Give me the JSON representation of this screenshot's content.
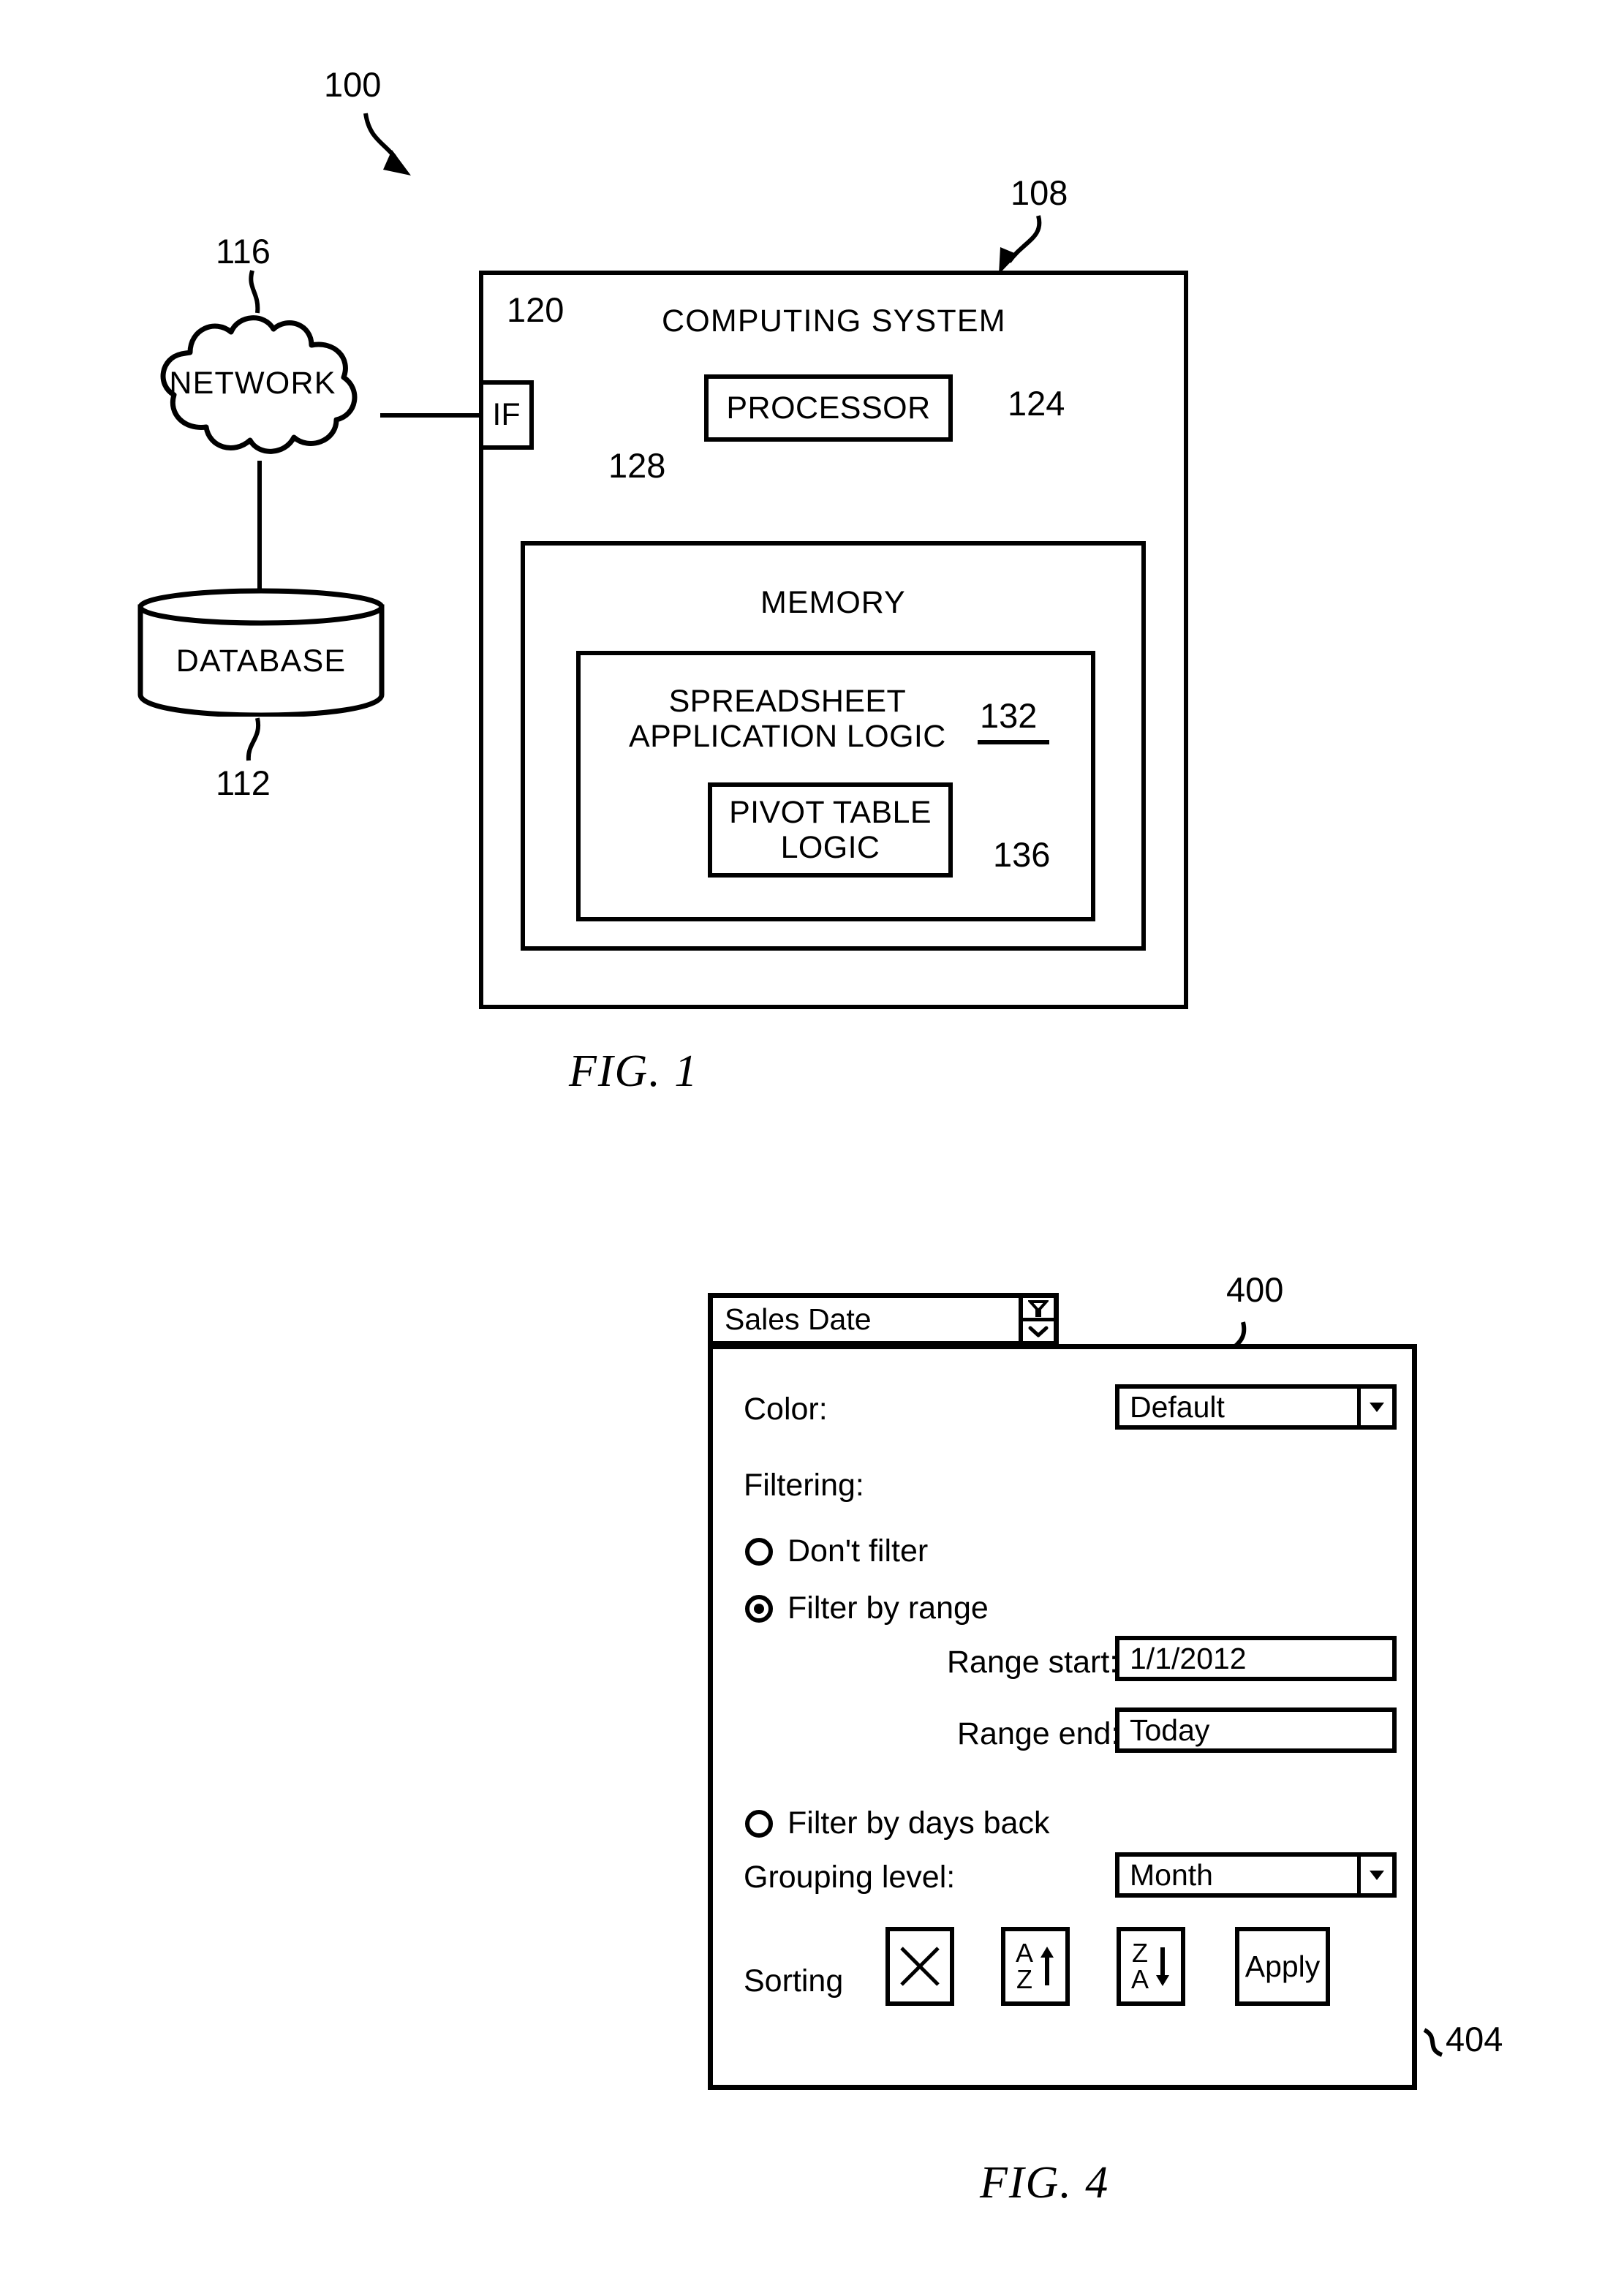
{
  "figures": [
    {
      "id": "fig1",
      "caption": "FIG. 1",
      "ref": "100",
      "nodes": {
        "network": "NETWORK",
        "network_ref": "116",
        "database": "DATABASE",
        "database_ref": "112",
        "computing_system": "COMPUTING SYSTEM",
        "computing_system_ref": "108",
        "interface": "IF",
        "interface_ref": "120",
        "processor": "PROCESSOR",
        "processor_ref": "124",
        "memory": "MEMORY",
        "memory_ref": "128",
        "spreadsheet_logic_line1": "SPREADSHEET",
        "spreadsheet_logic_line2": "APPLICATION LOGIC",
        "spreadsheet_logic_ref": "132",
        "pivot_logic_line1": "PIVOT TABLE",
        "pivot_logic_line2": "LOGIC",
        "pivot_logic_ref": "136"
      }
    },
    {
      "id": "fig4",
      "caption": "FIG. 4",
      "ref": "400",
      "apply_ref": "404"
    }
  ],
  "dialog": {
    "title": "Sales Date",
    "title_icons": {
      "filter": "filter-funnel-icon",
      "expand": "chevron-down-icon"
    },
    "color": {
      "label": "Color:",
      "value": "Default",
      "arrow_icon": "triangle-down-icon"
    },
    "filtering": {
      "label": "Filtering:",
      "options": [
        {
          "label": "Don't filter",
          "selected": false
        },
        {
          "label": "Filter by range",
          "selected": true
        },
        {
          "label": "Filter by days back",
          "selected": false
        }
      ]
    },
    "range_start": {
      "label": "Range start:",
      "value": "1/1/2012"
    },
    "range_end": {
      "label": "Range end:",
      "value": "Today"
    },
    "grouping": {
      "label": "Grouping level:",
      "value": "Month",
      "arrow_icon": "triangle-down-icon"
    },
    "sorting": {
      "label": "Sorting",
      "buttons": [
        {
          "name": "clear-sort",
          "icon": "x-cross-icon",
          "top": "",
          "bottom": ""
        },
        {
          "name": "sort-ascending",
          "icon": "arrow-up-icon",
          "top": "A",
          "bottom": "Z"
        },
        {
          "name": "sort-descending",
          "icon": "arrow-down-icon",
          "top": "Z",
          "bottom": "A"
        }
      ],
      "apply_label": "Apply"
    }
  },
  "colors": {
    "ink": "#000000",
    "paper": "#ffffff"
  }
}
